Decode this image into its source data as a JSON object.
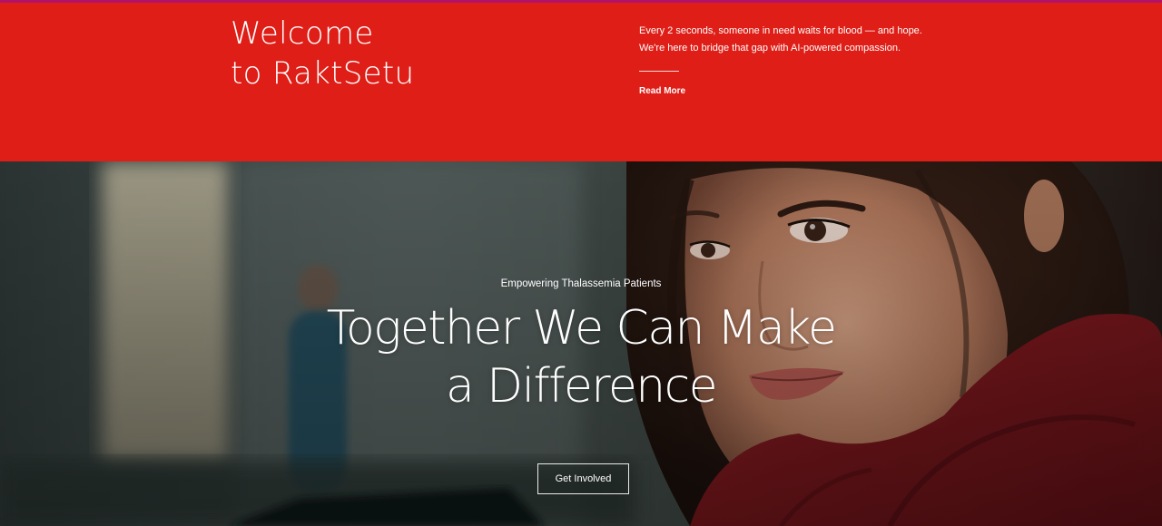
{
  "welcome": {
    "title_line1": "Welcome",
    "title_line2": "to RaktSetu",
    "intro_line1": "Every 2 seconds, someone in need waits for blood — and hope.",
    "intro_line2": "We're here to bridge that gap with AI-powered compassion.",
    "read_more_label": "Read More"
  },
  "hero": {
    "eyebrow": "Empowering Thalassemia Patients",
    "title_line1": "Together We Can Make",
    "title_line2": "a Difference",
    "cta_label": "Get Involved",
    "image_alt": "Smiling young woman wearing a red scarf in a hospital setting"
  },
  "colors": {
    "brand_red": "#de1e17",
    "top_accent": "#b3126b",
    "text_on_brand": "#ffffff"
  }
}
